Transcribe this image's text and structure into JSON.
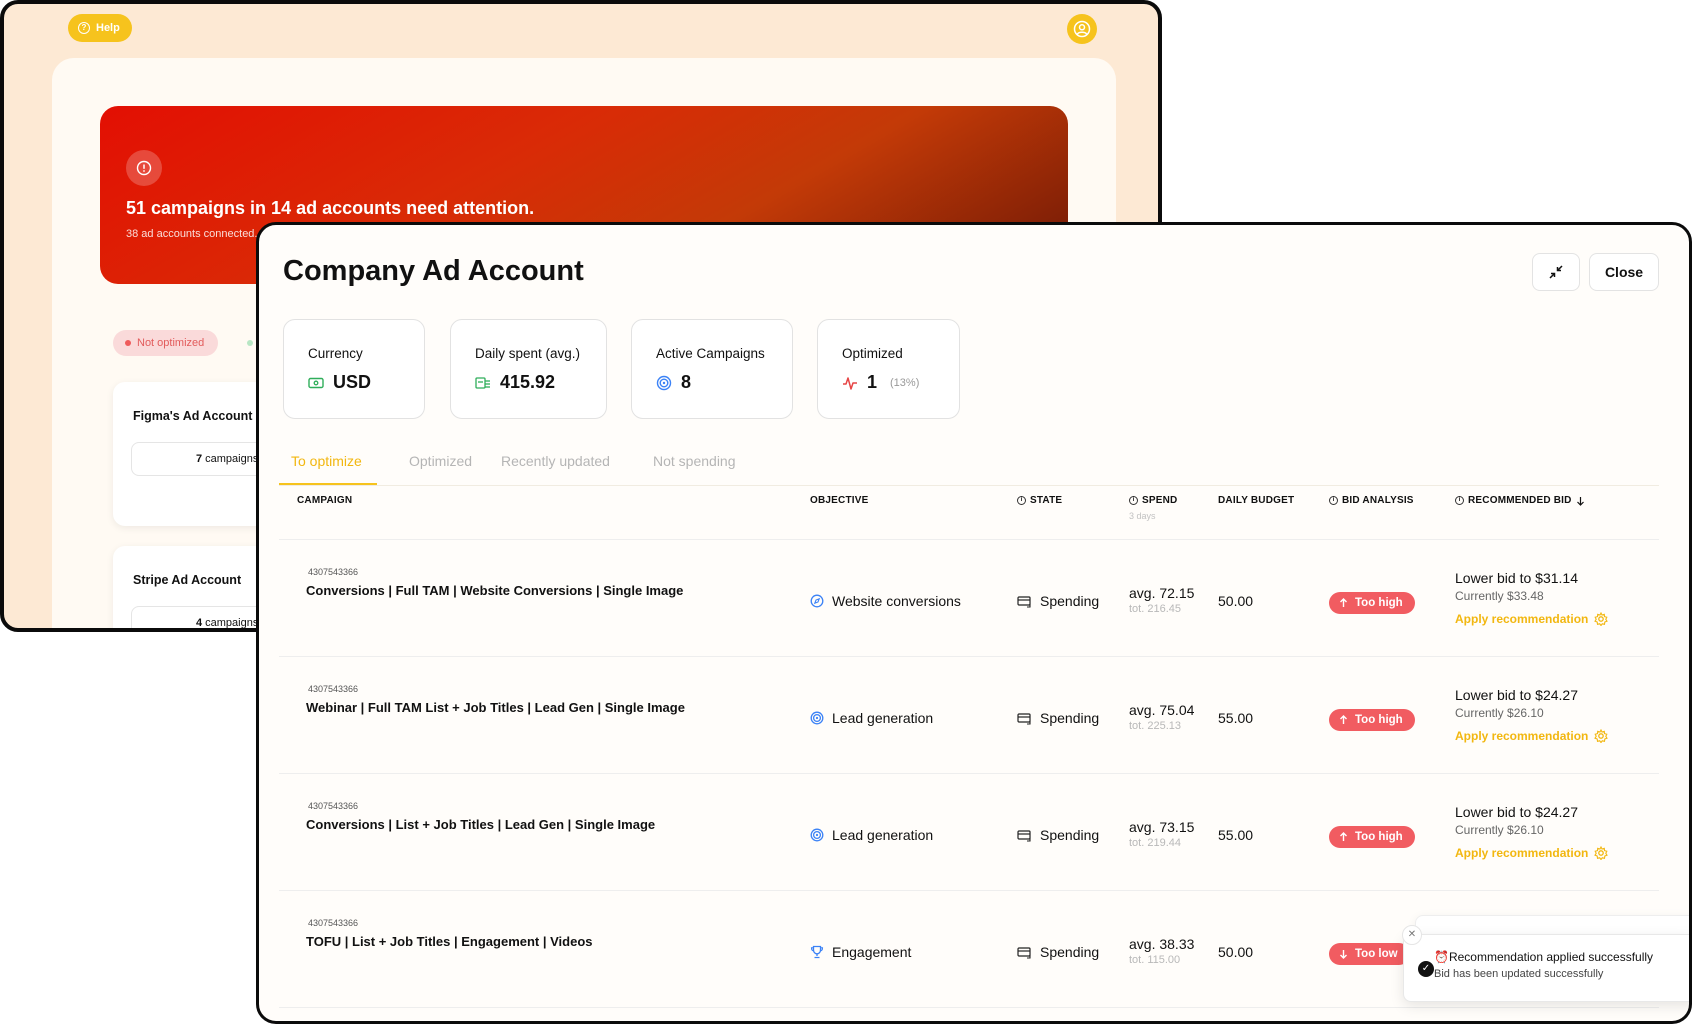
{
  "back": {
    "help_label": "Help",
    "alert_title": "51 campaigns in 14 ad accounts need attention.",
    "alert_sub": "38 ad accounts connected.",
    "filter_label": "Not optimized",
    "accounts": [
      {
        "name": "Figma's Ad Account",
        "count": "7",
        "suffix": "campaigns"
      },
      {
        "name": "Stripe Ad Account",
        "count": "4",
        "suffix": "campaigns"
      }
    ]
  },
  "modal": {
    "title": "Company Ad Account",
    "close_label": "Close",
    "stats": [
      {
        "label": "Currency",
        "value": "USD",
        "icon": "cash-icon"
      },
      {
        "label": "Daily spent (avg.)",
        "value": "415.92",
        "icon": "money-stack-icon"
      },
      {
        "label": "Active Campaigns",
        "value": "8",
        "icon": "target-icon"
      },
      {
        "label": "Optimized",
        "value": "1",
        "extra": "(13%)",
        "icon": "activity-icon"
      }
    ],
    "tabs": [
      "To optimize",
      "Optimized",
      "Recently updated",
      "Not spending"
    ],
    "columns": {
      "campaign": "CAMPAIGN",
      "objective": "OBJECTIVE",
      "state": "STATE",
      "spend": "SPEND",
      "spend_sub": "3 days",
      "daily_budget": "DAILY BUDGET",
      "bid_analysis": "BID ANALYSIS",
      "recommended_bid": "RECOMMENDED BID"
    },
    "rows": [
      {
        "id": "4307543366",
        "name": "Conversions | Full TAM | Website Conversions | Single Image",
        "objective": "Website conversions",
        "objective_icon": "compass-icon",
        "state": "Spending",
        "spend_avg": "avg. 72.15",
        "spend_tot": "tot. 216.45",
        "budget": "50.00",
        "bid": "Too high",
        "bid_dir": "up",
        "rec_lower": "Lower bid to $31.14",
        "rec_current": "Currently $33.48",
        "apply": "Apply recommendation"
      },
      {
        "id": "4307543366",
        "name": "Webinar | Full TAM List + Job Titles | Lead Gen | Single Image",
        "objective": "Lead generation",
        "objective_icon": "target-icon",
        "state": "Spending",
        "spend_avg": "avg. 75.04",
        "spend_tot": "tot. 225.13",
        "budget": "55.00",
        "bid": "Too high",
        "bid_dir": "up",
        "rec_lower": "Lower bid to $24.27",
        "rec_current": "Currently $26.10",
        "apply": "Apply recommendation"
      },
      {
        "id": "4307543366",
        "name": "Conversions | List + Job Titles | Lead Gen | Single Image",
        "objective": "Lead generation",
        "objective_icon": "target-icon",
        "state": "Spending",
        "spend_avg": "avg. 73.15",
        "spend_tot": "tot. 219.44",
        "budget": "55.00",
        "bid": "Too high",
        "bid_dir": "up",
        "rec_lower": "Lower bid to $24.27",
        "rec_current": "Currently $26.10",
        "apply": "Apply recommendation"
      },
      {
        "id": "4307543366",
        "name": "TOFU | List + Job Titles | Engagement | Videos",
        "objective": "Engagement",
        "objective_icon": "trophy-icon",
        "state": "Spending",
        "spend_avg": "avg. 38.33",
        "spend_tot": "tot. 115.00",
        "budget": "50.00",
        "bid": "Too low",
        "bid_dir": "down"
      }
    ],
    "toast": {
      "title": "Recommendation applied successfully",
      "body": "Bid has been updated successfully"
    }
  },
  "colors": {
    "accent": "#f6c31d",
    "danger": "#f15c61",
    "banner": "#d92b06"
  }
}
